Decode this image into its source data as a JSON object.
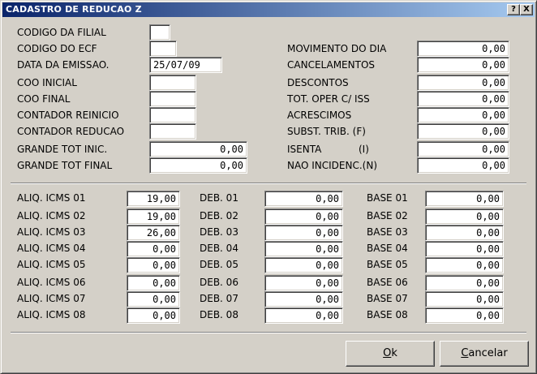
{
  "window": {
    "title": "CADASTRO DE REDUCAO Z",
    "help_label": "?",
    "close_label": "X"
  },
  "left_fields": [
    {
      "label": "CODIGO DA FILIAL",
      "value": ""
    },
    {
      "label": "CODIGO DO ECF",
      "value": ""
    },
    {
      "label": "DATA DA EMISSAO.",
      "value": "25/07/09"
    },
    {
      "label": "COO INICIAL",
      "value": ""
    },
    {
      "label": "COO FINAL",
      "value": ""
    },
    {
      "label": "CONTADOR REINICIO",
      "value": ""
    },
    {
      "label": "CONTADOR REDUCAO",
      "value": ""
    },
    {
      "label": "GRANDE TOT INIC.",
      "value": "0,00"
    },
    {
      "label": "GRANDE TOT FINAL",
      "value": "0,00"
    }
  ],
  "right_fields": [
    {
      "label": "MOVIMENTO DO DIA",
      "value": "0,00"
    },
    {
      "label": "CANCELAMENTOS",
      "value": "0,00"
    },
    {
      "label": "DESCONTOS",
      "value": "0,00"
    },
    {
      "label": "TOT. OPER C/ ISS",
      "value": "0,00"
    },
    {
      "label": "ACRESCIMOS",
      "value": "0,00"
    },
    {
      "label": "SUBST. TRIB. (F)",
      "value": "0,00"
    },
    {
      "label": "ISENTA",
      "label_suffix": "(I)",
      "value": "0,00"
    },
    {
      "label": "NAO INCIDENC.(N)",
      "value": "0,00"
    }
  ],
  "aliq": [
    {
      "label": "ALIQ. ICMS 01",
      "value": "19,00"
    },
    {
      "label": "ALIQ. ICMS 02",
      "value": "19,00"
    },
    {
      "label": "ALIQ. ICMS 03",
      "value": "26,00"
    },
    {
      "label": "ALIQ. ICMS 04",
      "value": "0,00"
    },
    {
      "label": "ALIQ. ICMS 05",
      "value": "0,00"
    },
    {
      "label": "ALIQ. ICMS 06",
      "value": "0,00"
    },
    {
      "label": "ALIQ. ICMS 07",
      "value": "0,00"
    },
    {
      "label": "ALIQ. ICMS 08",
      "value": "0,00"
    }
  ],
  "deb": [
    {
      "label": "DEB. 01",
      "value": "0,00"
    },
    {
      "label": "DEB. 02",
      "value": "0,00"
    },
    {
      "label": "DEB. 03",
      "value": "0,00"
    },
    {
      "label": "DEB. 04",
      "value": "0,00"
    },
    {
      "label": "DEB. 05",
      "value": "0,00"
    },
    {
      "label": "DEB. 06",
      "value": "0,00"
    },
    {
      "label": "DEB. 07",
      "value": "0,00"
    },
    {
      "label": "DEB. 08",
      "value": "0,00"
    }
  ],
  "base": [
    {
      "label": "BASE 01",
      "value": "0,00"
    },
    {
      "label": "BASE 02",
      "value": "0,00"
    },
    {
      "label": "BASE 03",
      "value": "0,00"
    },
    {
      "label": "BASE 04",
      "value": "0,00"
    },
    {
      "label": "BASE 05",
      "value": "0,00"
    },
    {
      "label": "BASE 06",
      "value": "0,00"
    },
    {
      "label": "BASE 07",
      "value": "0,00"
    },
    {
      "label": "BASE 08",
      "value": "0,00"
    }
  ],
  "buttons": {
    "ok_accel": "O",
    "ok_rest": "k",
    "cancel_accel": "C",
    "cancel_rest": "ancelar"
  }
}
